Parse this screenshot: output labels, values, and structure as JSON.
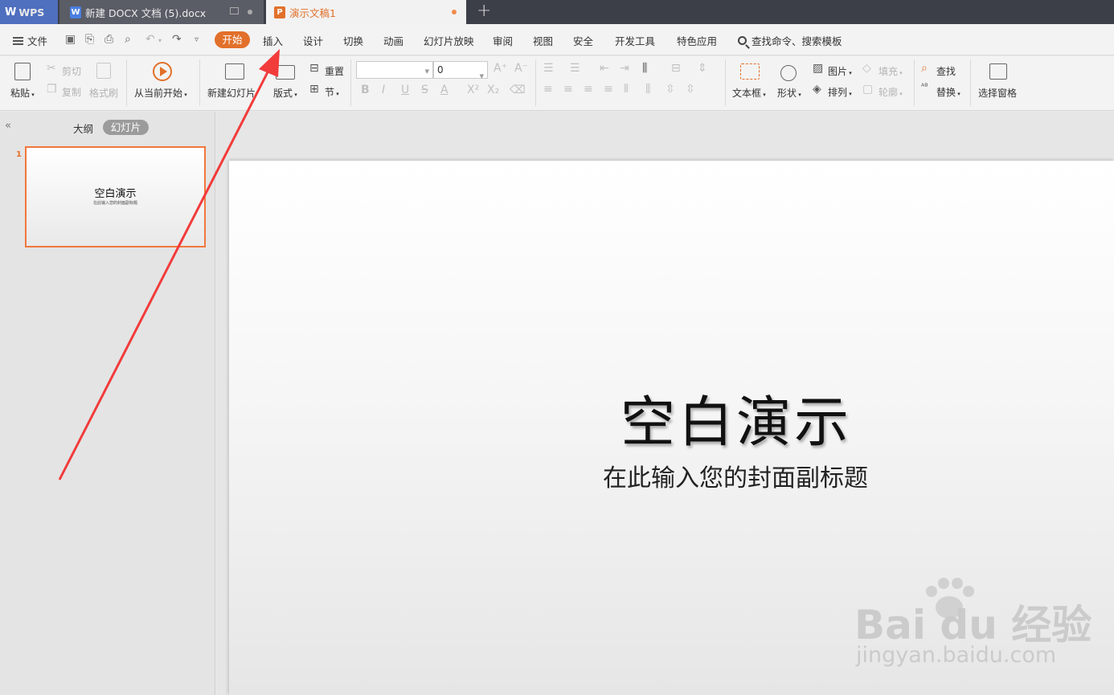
{
  "tabs": {
    "wps_label": "WPS",
    "doc_title": "新建 DOCX 文档 (5).docx",
    "doc_icon": "W",
    "ppt_title": "演示文稿1",
    "ppt_icon": "P",
    "add": "+"
  },
  "menu": {
    "file": "文件",
    "items": [
      "开始",
      "插入",
      "设计",
      "切换",
      "动画",
      "幻灯片放映",
      "审阅",
      "视图",
      "安全",
      "开发工具",
      "特色应用"
    ],
    "active_index": 0,
    "search": "查找命令、搜索模板"
  },
  "ribbon": {
    "paste": "粘贴",
    "cut": "剪切",
    "copy": "复制",
    "format_painter": "格式刷",
    "from_current": "从当前开始",
    "new_slide": "新建幻灯片",
    "layout": "版式",
    "reset": "重置",
    "section": "节",
    "font_size": "0",
    "text_box": "文本框",
    "shape": "形状",
    "picture": "图片",
    "arrange": "排列",
    "fill": "填充",
    "outline": "轮廓",
    "find": "查找",
    "replace": "替换",
    "selection_pane": "选择窗格"
  },
  "panel": {
    "outline_tab": "大纲",
    "slides_tab": "幻灯片",
    "collapse": "«",
    "thumb_number": "1",
    "thumb_title": "空白演示",
    "thumb_subtitle": "在此输入您的封面副标题"
  },
  "slide": {
    "title": "空白演示",
    "subtitle": "在此输入您的封面副标题"
  },
  "watermark": {
    "brand": "Bai du 经验",
    "url": "jingyan.baidu.com"
  },
  "colors": {
    "accent": "#e2702a",
    "tabbar": "#3c3f48",
    "wps_blue": "#4f6fbf",
    "annotation_arrow": "#f23b3b"
  }
}
